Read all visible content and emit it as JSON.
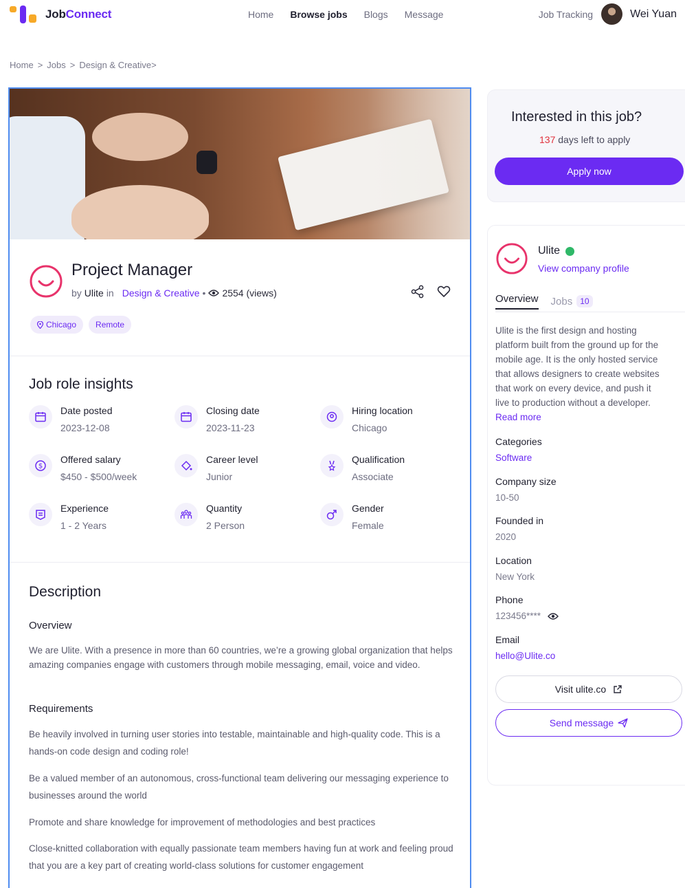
{
  "header": {
    "brand_part1": "Job",
    "brand_part2": "Connect",
    "nav": [
      "Home",
      "Browse jobs",
      "Blogs",
      "Message"
    ],
    "job_tracking": "Job Tracking",
    "user_name": "Wei Yuan"
  },
  "breadcrumb": [
    "Home",
    ">",
    "Jobs",
    ">",
    "Design & Creative>"
  ],
  "job": {
    "title": "Project Manager",
    "by": "by",
    "company": "Ulite",
    "in": "in",
    "category": "Design & Creative",
    "dot": "•",
    "views": "2554 (views)",
    "tags": [
      "Chicago",
      "Remote"
    ]
  },
  "insights": {
    "title": "Job role insights",
    "items": [
      {
        "label": "Date posted",
        "value": "2023-12-08",
        "icon": "calendar-icon"
      },
      {
        "label": "Closing date",
        "value": "2023-11-23",
        "icon": "calendar-icon"
      },
      {
        "label": "Hiring location",
        "value": "Chicago",
        "icon": "location-pin-icon"
      },
      {
        "label": "Offered salary",
        "value": "$450 - $500/week",
        "icon": "dollar-coin-icon"
      },
      {
        "label": "Career level",
        "value": "Junior",
        "icon": "paint-bucket-icon"
      },
      {
        "label": "Qualification",
        "value": "Associate",
        "icon": "medal-icon"
      },
      {
        "label": "Experience",
        "value": "1 - 2 Years",
        "icon": "document-list-icon"
      },
      {
        "label": "Quantity",
        "value": "2 Person",
        "icon": "people-group-icon"
      },
      {
        "label": "Gender",
        "value": "Female",
        "icon": "gender-male-icon"
      }
    ]
  },
  "description": {
    "title": "Description",
    "overview_title": "Overview",
    "overview_text": "We are Ulite. With a presence in more than 60 countries, we’re a growing global organization that helps amazing companies engage with customers through mobile messaging, email, voice and video.",
    "requirements_title": "Requirements",
    "requirements": [
      "Be heavily involved in turning user stories into testable, maintainable and high-quality code. This is a hands-on code design and coding role!",
      "Be a valued member of an autonomous, cross-functional team delivering our messaging experience to businesses around the world",
      "Promote and share knowledge for improvement of methodologies and best practices",
      "Close-knitted collaboration with equally passionate team members having fun at work and feeling proud that you are a key part of creating world-class solutions for customer engagement"
    ]
  },
  "apply": {
    "title": "Interested in this job?",
    "days": "137",
    "days_suffix": "days left to apply",
    "button": "Apply now"
  },
  "company": {
    "name": "Ulite",
    "profile_link": "View company profile",
    "tab_overview": "Overview",
    "tab_jobs": "Jobs",
    "jobs_count": "10",
    "about_lines": [
      "Ulite is the first design and hosting",
      "platform built from the ground up for the",
      "mobile age. It is the only hosted service",
      "that allows designers to create websites",
      "that work on every device, and push it",
      "live to production without a developer."
    ],
    "read_more": "Read more",
    "fields": [
      {
        "label": "Categories",
        "value": "Software"
      },
      {
        "label": "Company size",
        "value": "10-50"
      },
      {
        "label": "Founded in",
        "value": "2020"
      },
      {
        "label": "Location",
        "value": "New York"
      },
      {
        "label": "Phone",
        "value": "123456****"
      },
      {
        "label": "Email",
        "value": "hello@Ulite.co"
      }
    ],
    "visit_button": "Visit ulite.co",
    "message_button": "Send message"
  },
  "colors": {
    "accent": "#6b2bf2",
    "logo_ring": "#e8336b",
    "days_red": "#e0323d",
    "verified_green": "#2fb868",
    "selection_blue": "#4f8cf0"
  }
}
